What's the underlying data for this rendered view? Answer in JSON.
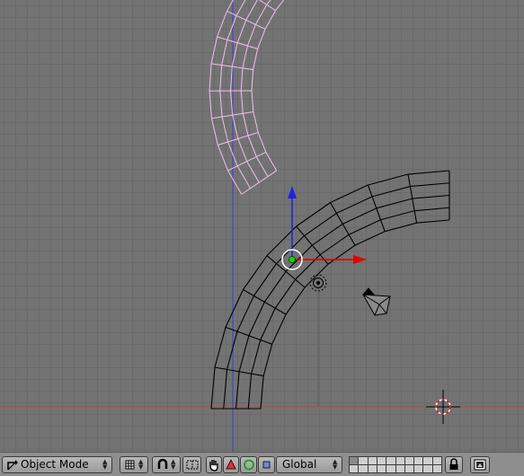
{
  "header": {
    "mode_menu": {
      "label": "Object Mode",
      "icon": "object-mode-icon"
    },
    "draw_type_icon": "solid-cube-icon",
    "pivot_icon": "pivot-point-icon",
    "snap_icon": "magnet-icon",
    "widget_icons": [
      "hand-icon",
      "translate-triangle-icon",
      "rotate-ring-icon",
      "scale-square-icon"
    ],
    "orientation_menu": {
      "label": "Global"
    },
    "layers": {
      "count": 20,
      "active": [
        0
      ]
    },
    "lock_icon": "lock-icon",
    "render_icon": "render-image-icon"
  },
  "viewport": {
    "colors": {
      "background": "#737373",
      "grid": "#6a6a6a",
      "x_axis": "#b84a4a",
      "z_axis": "#3d3dd0",
      "selected_wire": "#f0c0f0",
      "wire": "#000000",
      "manip_x": "#e00000",
      "manip_z": "#2020e0",
      "origin": "#00e000"
    }
  }
}
